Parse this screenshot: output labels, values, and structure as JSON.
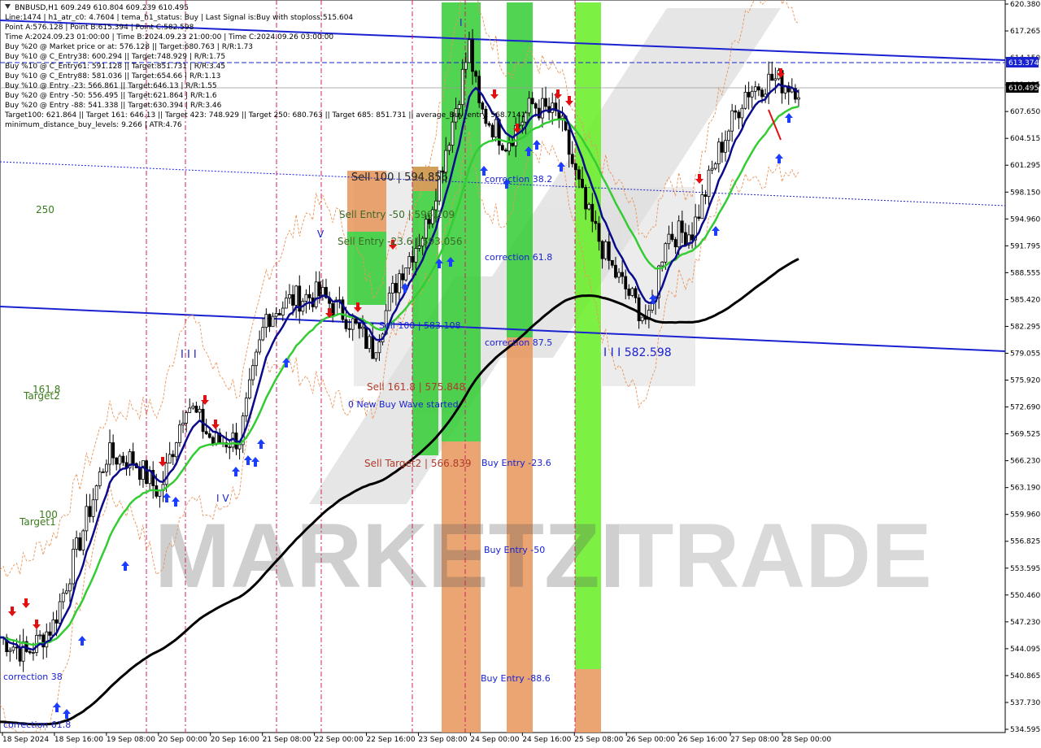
{
  "symbol_line": "BNBUSD,H1  609.249 610.804 609.239 610.495",
  "info_lines": [
    "Line:1474 | h1_atr_c0: 4.7604 | tema_h1_status: Buy | Last Signal is:Buy with stoploss:515.604",
    "Point A:576.128 | Point B:615.394 | Point C:582.598",
    "Time A:2024.09.23 01:00:00 | Time B:2024.09.23 21:00:00 | Time C:2024.09.26 03:00:00",
    "Buy %20 @ Market price or at: 576.128 || Target:680.763 | R/R:1.73",
    "Buy %10 @ C_Entry38: 600.294 || Target:748.929 | R/R:1.75",
    "Buy %10 @ C_Entry61: 591.128 || Target:851.731 | R/R:3.45",
    "Buy %10 @ C_Entry88: 581.036 || Target:654.66 | R/R:1.13",
    "Buy %10 @ Entry -23: 566.861 || Target:646.13 | R/R:1.55",
    "Buy %20 @ Entry -50: 556.495 || Target:621.864 | R/R:1.6",
    "Buy %20 @ Entry -88: 541.338 || Target:630.394 | R/R:3.46",
    "Target100: 621.864 || Target 161: 646.13 || Target 423: 748.929 || Target 250: 680.763 || Target 685: 851.731 || average_Buy_entry: 568.7141",
    "minimum_distance_buy_levels: 9.266 | ATR:4.76"
  ],
  "price_axis": [
    "620.380",
    "617.265",
    "614.150",
    "611.035",
    "607.650",
    "604.515",
    "601.295",
    "598.150",
    "594.960",
    "591.795",
    "588.555",
    "585.420",
    "582.295",
    "579.055",
    "575.920",
    "572.690",
    "569.525",
    "566.230",
    "563.190",
    "559.960",
    "556.825",
    "553.595",
    "550.460",
    "547.230",
    "544.095",
    "540.865",
    "537.730",
    "534.595"
  ],
  "price_tags": {
    "upper_line": "613.374",
    "current": "610.495"
  },
  "time_axis": [
    "18 Sep 2024",
    "18 Sep 16:00",
    "19 Sep 08:00",
    "20 Sep 00:00",
    "20 Sep 16:00",
    "21 Sep 08:00",
    "22 Sep 00:00",
    "22 Sep 16:00",
    "23 Sep 08:00",
    "24 Sep 00:00",
    "24 Sep 16:00",
    "25 Sep 08:00",
    "26 Sep 00:00",
    "26 Sep 16:00",
    "27 Sep 08:00",
    "28 Sep 00:00"
  ],
  "labels": {
    "l250": "250",
    "l1618": "161.8",
    "target2": "Target2",
    "l100": "100",
    "target1": "Target1",
    "corr618_bottom": "correction 61.8",
    "corr_bottom2": "correction 38",
    "sell_100": "Sell 100 | 594.856",
    "sell_entry_50": "Sell Entry -50 | 596.209",
    "sell_entry_236": "Sell Entry -23.6 | 593.056",
    "sell_line_583": "Sell 100 | 583.108",
    "sell_1618": "Sell 161.8 | 575.848",
    "new_buy_wave": "0 New Buy Wave started",
    "sell_target2": "Sell Target2 | 566.839",
    "corr382": "correction 38.2",
    "corr618": "correction 61.8",
    "corr875": "correction 87.5",
    "buy_entry_236": "Buy Entry -23.6",
    "buy_entry_50": "Buy Entry -50",
    "buy_entry_886": "Buy Entry -88.6",
    "point_c": "I I I 582.598",
    "wave_iii": "I I I",
    "wave_v": "V",
    "wave_iv": "I V",
    "wave_i": "I",
    "watermark_left": "MARKETZI",
    "watermark_right": "TRADE"
  },
  "colors": {
    "bull_green": "#33cc33",
    "lime": "#66ee22",
    "orange": "#e8955a",
    "navy": "#0a0a8c",
    "blue_line": "#1a22d0",
    "ma_green": "#33cc33",
    "ma_black": "#000000",
    "buy_arrow": "#1a3dff",
    "sell_arrow": "#e01010",
    "pink_vline": "#d0206a",
    "label_tag": "#1a22d0"
  },
  "chart_data": {
    "type": "candlestick",
    "title": "BNBUSD,H1",
    "ohlc_last": {
      "open": 609.249,
      "high": 610.804,
      "low": 609.239,
      "close": 610.495
    },
    "ylim": [
      534.595,
      620.38
    ],
    "x_range": [
      "2024-09-18 00:00",
      "2024-09-28 00:00"
    ],
    "levels": {
      "point_a": 576.128,
      "point_b": 615.394,
      "point_c": 582.598,
      "stoploss": 515.604
    },
    "price_path_approx": [
      [
        "2024-09-18 00:00",
        545.5
      ],
      [
        "2024-09-18 08:00",
        543.5
      ],
      [
        "2024-09-18 16:00",
        547.0
      ],
      [
        "2024-09-19 00:00",
        557.0
      ],
      [
        "2024-09-19 08:00",
        567.0
      ],
      [
        "2024-09-19 16:00",
        566.5
      ],
      [
        "2024-09-20 00:00",
        562.5
      ],
      [
        "2024-09-20 08:00",
        573.5
      ],
      [
        "2024-09-20 16:00",
        568.5
      ],
      [
        "2024-09-21 00:00",
        569.0
      ],
      [
        "2024-09-21 08:00",
        583.5
      ],
      [
        "2024-09-21 16:00",
        585.5
      ],
      [
        "2024-09-22 00:00",
        586.0
      ],
      [
        "2024-09-22 08:00",
        583.5
      ],
      [
        "2024-09-22 16:00",
        579.5
      ],
      [
        "2024-09-23 00:00",
        588.5
      ],
      [
        "2024-09-23 08:00",
        594.0
      ],
      [
        "2024-09-23 16:00",
        606.5
      ],
      [
        "2024-09-23 21:00",
        615.4
      ],
      [
        "2024-09-24 00:00",
        608.0
      ],
      [
        "2024-09-24 08:00",
        604.0
      ],
      [
        "2024-09-24 16:00",
        608.5
      ],
      [
        "2024-09-25 00:00",
        607.0
      ],
      [
        "2024-09-25 08:00",
        596.0
      ],
      [
        "2024-09-25 16:00",
        589.0
      ],
      [
        "2024-09-26 03:00",
        582.6
      ],
      [
        "2024-09-26 08:00",
        593.0
      ],
      [
        "2024-09-26 16:00",
        593.5
      ],
      [
        "2024-09-27 00:00",
        603.0
      ],
      [
        "2024-09-27 08:00",
        610.0
      ],
      [
        "2024-09-27 16:00",
        611.5
      ],
      [
        "2024-09-28 00:00",
        610.5
      ]
    ]
  }
}
